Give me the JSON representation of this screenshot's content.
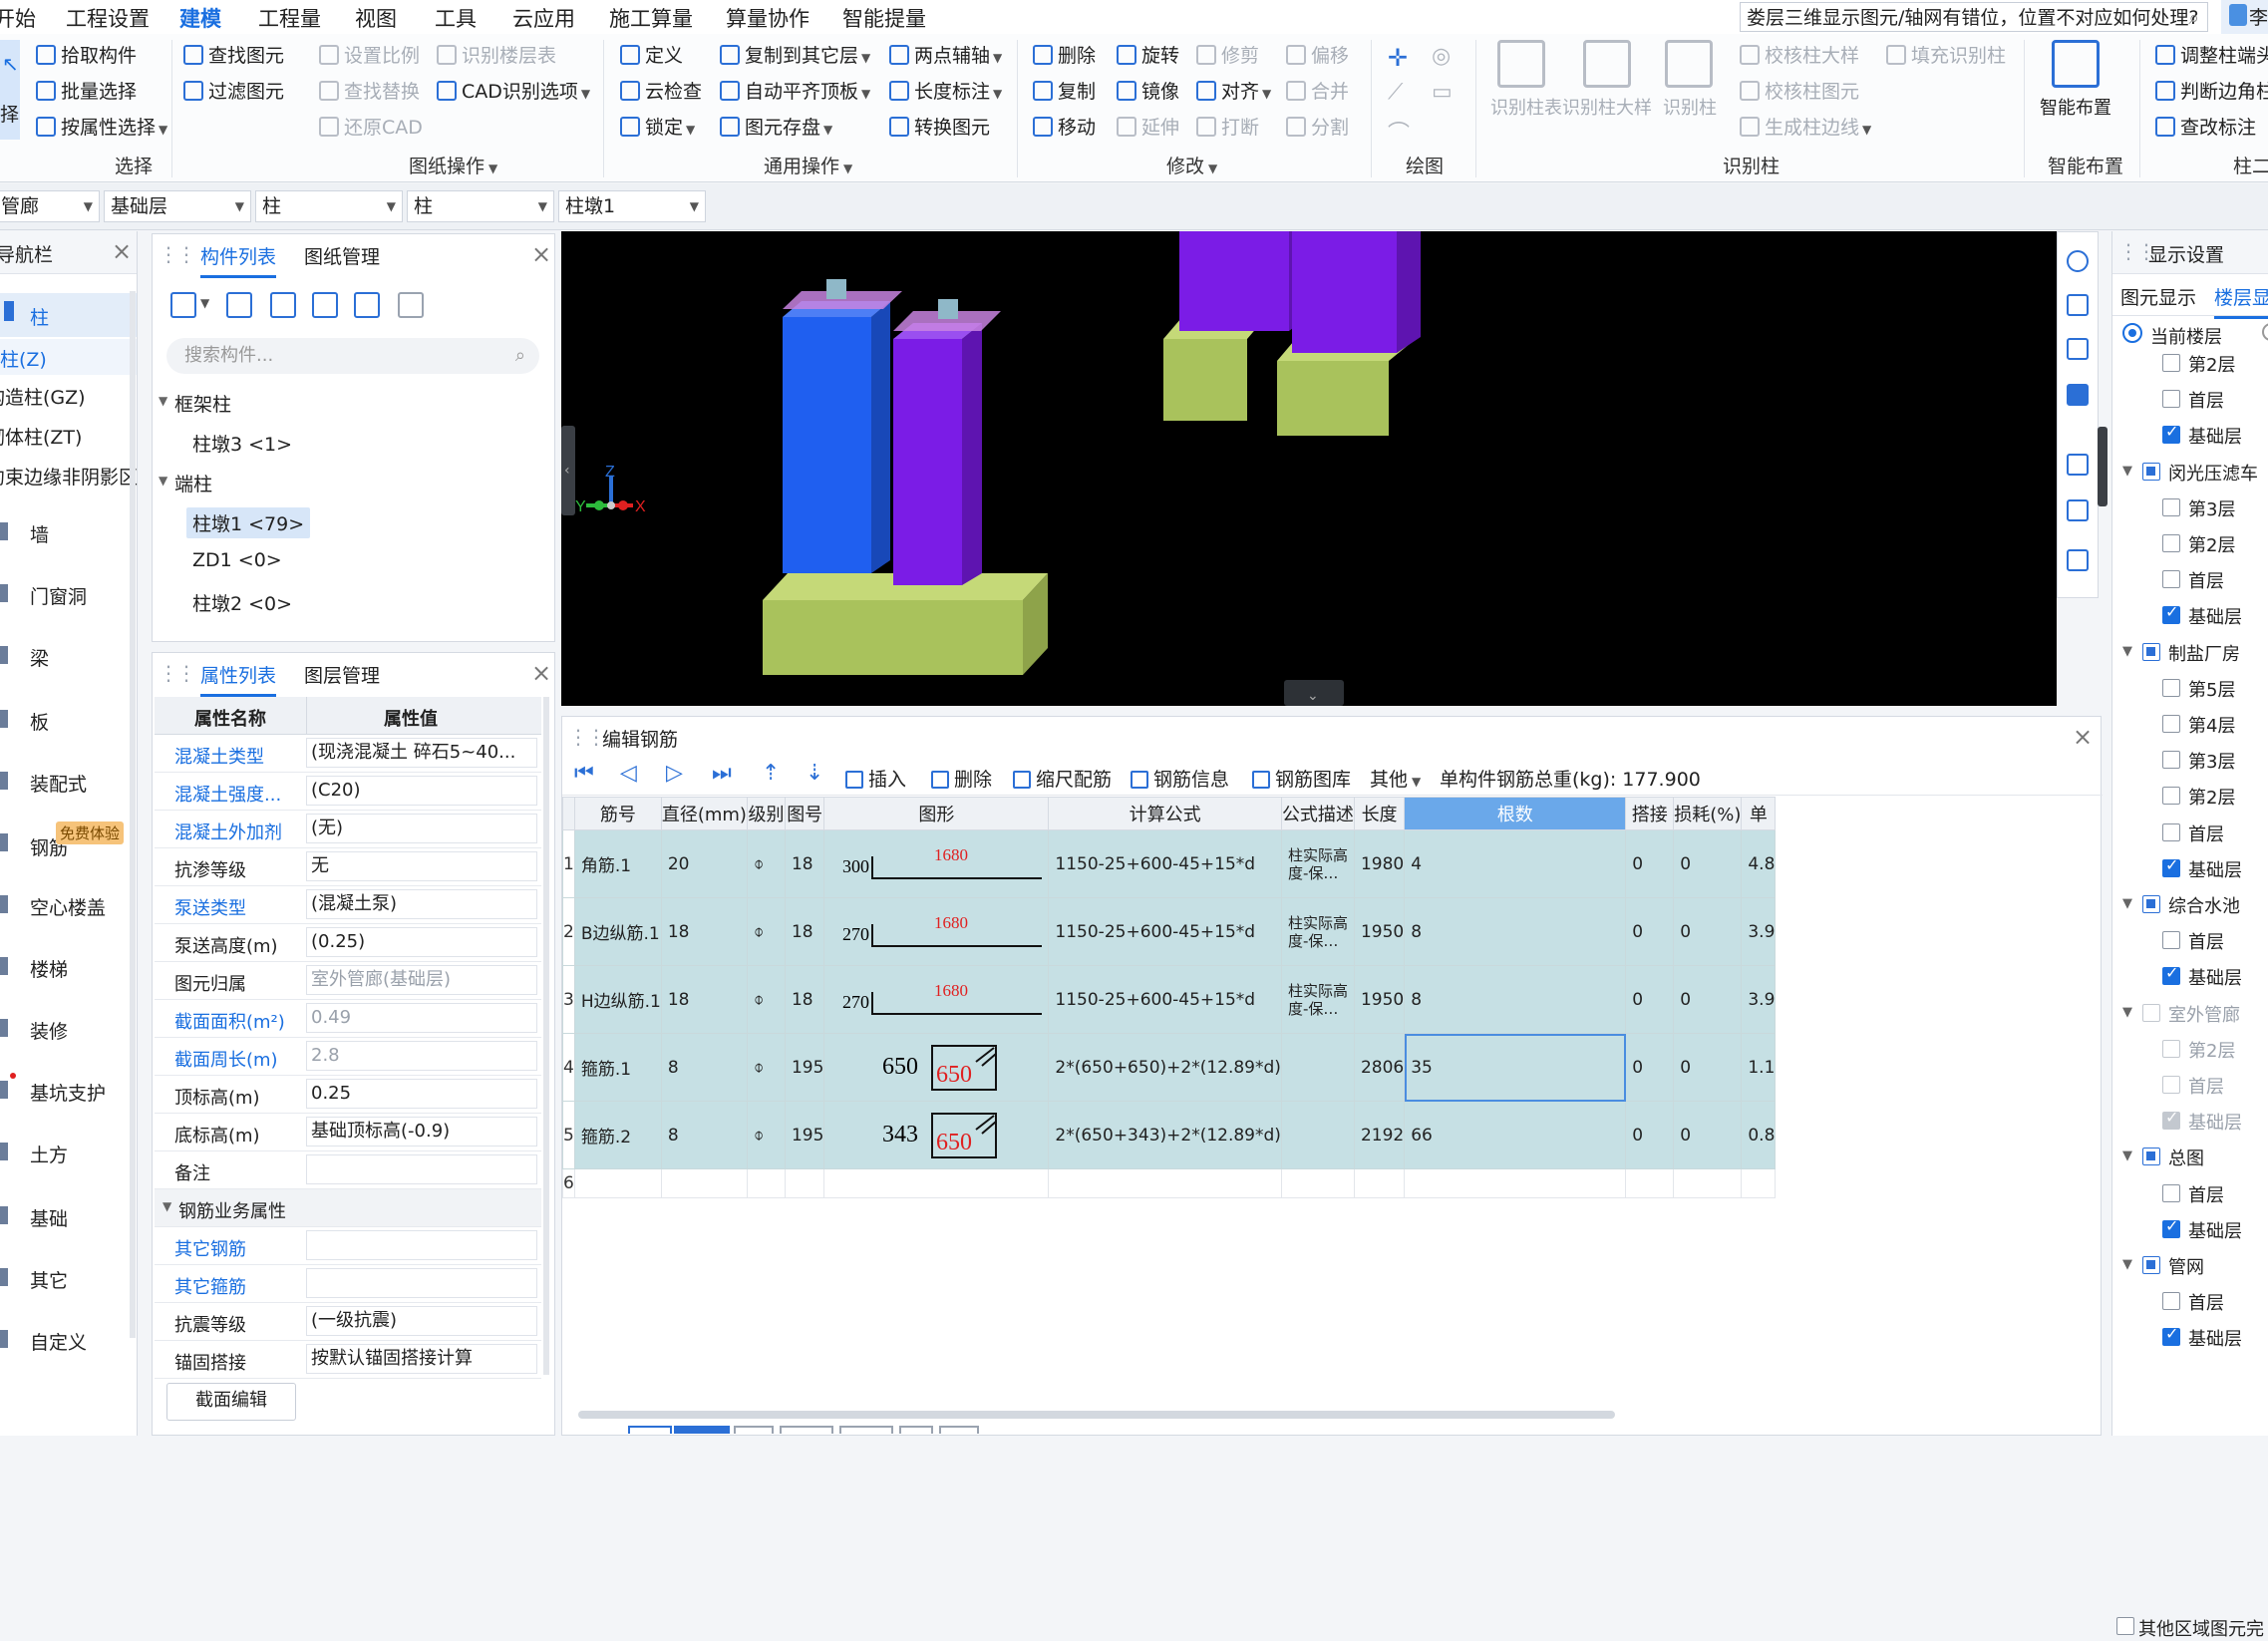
{
  "menubar": {
    "items": [
      "开始",
      "工程设置",
      "建模",
      "工程量",
      "视图",
      "工具",
      "云应用",
      "施工算量",
      "算量协作",
      "智能提量"
    ],
    "active": "建模",
    "help_text": "娄层三维显示图元/轴网有错位，位置不对应如何处理?",
    "user": "李"
  },
  "ribbon": {
    "select_group": {
      "label": "选择",
      "big_button": "择",
      "buttons": [
        "拾取构件",
        "批量选择",
        "按属性选择"
      ]
    },
    "drawing_ops": {
      "label": "图纸操作",
      "col1": [
        "查找图元",
        "过滤图元"
      ],
      "col2": [
        "设置比例",
        "查找替换",
        "还原CAD"
      ],
      "col3": [
        "识别楼层表",
        "CAD识别选项"
      ]
    },
    "general_ops": {
      "label": "通用操作",
      "col1": [
        "定义",
        "云检查",
        "锁定"
      ],
      "col2": [
        "复制到其它层",
        "自动平齐顶板",
        "图元存盘"
      ],
      "col3": [
        "两点辅轴",
        "长度标注",
        "转换图元"
      ]
    },
    "modify": {
      "label": "修改",
      "col1": [
        "删除",
        "复制",
        "移动"
      ],
      "col2": [
        "旋转",
        "镜像",
        "延伸"
      ],
      "col3": [
        "修剪",
        "对齐",
        "打断"
      ],
      "col4": [
        "偏移",
        "合并",
        "分割"
      ]
    },
    "draw": {
      "label": "绘图"
    },
    "recognize_col": {
      "label": "识别柱",
      "big_buttons": [
        "识别柱表",
        "识别柱大样",
        "识别柱"
      ],
      "small": [
        "校核柱大样",
        "校核柱图元",
        "生成柱边线",
        "填充识别柱"
      ]
    },
    "smart_layout": {
      "label": "智能布置",
      "big_button": "智能布置"
    },
    "column_extra": {
      "label": "柱二",
      "buttons": [
        "调整柱端头",
        "判断边角柱",
        "查改标注"
      ]
    }
  },
  "selectors": [
    "管廊",
    "基础层",
    "柱",
    "柱",
    "柱墩1"
  ],
  "nav": {
    "title": "导航栏",
    "items": [
      "柱",
      "柱(Z)",
      "构造柱(GZ)",
      "砌体柱(ZT)",
      "约束边缘非阴影区",
      "墙",
      "门窗洞",
      "梁",
      "板",
      "装配式",
      "钢筋",
      "空心楼盖",
      "楼梯",
      "装修",
      "基坑支护",
      "土方",
      "基础",
      "其它",
      "自定义"
    ],
    "badge": "免费体验"
  },
  "component_panel": {
    "tabs": [
      "构件列表",
      "图纸管理"
    ],
    "search_placeholder": "搜索构件...",
    "tree": [
      {
        "label": "框架柱",
        "type": "group"
      },
      {
        "label": "柱墩3 <1>",
        "type": "item"
      },
      {
        "label": "端柱",
        "type": "group"
      },
      {
        "label": "柱墩1 <79>",
        "type": "item",
        "selected": true
      },
      {
        "label": "ZD1 <0>",
        "type": "item"
      },
      {
        "label": "柱墩2 <0>",
        "type": "item"
      }
    ]
  },
  "property_panel": {
    "tabs": [
      "属性列表",
      "图层管理"
    ],
    "header": [
      "属性名称",
      "属性值"
    ],
    "rows": [
      {
        "name": "混凝土类型",
        "value": "(现浇混凝土    碎石5~40...",
        "blue": true
      },
      {
        "name": "混凝土强度...",
        "value": "(C20)",
        "blue": true
      },
      {
        "name": "混凝土外加剂",
        "value": "(无)",
        "blue": true
      },
      {
        "name": "抗渗等级",
        "value": "无",
        "blue": false
      },
      {
        "name": "泵送类型",
        "value": "(混凝土泵)",
        "blue": true
      },
      {
        "name": "泵送高度(m)",
        "value": "(0.25)",
        "blue": false
      },
      {
        "name": "图元归属",
        "value": "室外管廊(基础层)",
        "blue": false,
        "grey": true
      },
      {
        "name": "截面面积(m²)",
        "value": "0.49",
        "blue": true,
        "grey": true
      },
      {
        "name": "截面周长(m)",
        "value": "2.8",
        "blue": true,
        "grey": true
      },
      {
        "name": "顶标高(m)",
        "value": "0.25",
        "blue": false
      },
      {
        "name": "底标高(m)",
        "value": "基础顶标高(-0.9)",
        "blue": false
      },
      {
        "name": "备注",
        "value": "",
        "blue": false
      }
    ],
    "section": "钢筋业务属性",
    "rows2": [
      {
        "name": "其它钢筋",
        "value": "",
        "blue": true
      },
      {
        "name": "其它箍筋",
        "value": "",
        "blue": true
      },
      {
        "name": "抗震等级",
        "value": "(一级抗震)",
        "blue": false
      },
      {
        "name": "锚固搭接",
        "value": "按默认锚固搭接计算",
        "blue": false
      }
    ],
    "section_edit": "截面编辑"
  },
  "view3d": {
    "axis": {
      "x": "X",
      "y": "Y",
      "z": "Z"
    },
    "colors": {
      "footing": "#a7c25a",
      "col_blue": "#1f5ff0",
      "col_purple": "#7b1ce6",
      "cap": "#c77fe0"
    }
  },
  "rebar_editor": {
    "title": "编辑钢筋",
    "toolbar": [
      "插入",
      "删除",
      "缩尺配筋",
      "钢筋信息",
      "钢筋图库",
      "其他"
    ],
    "total_label": "单构件钢筋总重(kg):",
    "total_value": "177.900",
    "columns": [
      "",
      "筋号",
      "直径(mm)",
      "级别",
      "图号",
      "图形",
      "计算公式",
      "公式描述",
      "长度",
      "根数",
      "搭接",
      "损耗(%)",
      "单"
    ],
    "rows": [
      {
        "no": "1",
        "name": "角筋.1",
        "dia": "20",
        "grade": "⌽",
        "fig": "18",
        "shape": {
          "type": "L",
          "left": "300",
          "len": "1680"
        },
        "formula": "1150-25+600-45+15*d",
        "desc": "柱实际高度-保…",
        "length": "1980",
        "count": "4",
        "lap": "0",
        "loss": "0",
        "unit": "4.8"
      },
      {
        "no": "2",
        "name": "B边纵筋.1",
        "dia": "18",
        "grade": "⌽",
        "fig": "18",
        "shape": {
          "type": "L",
          "left": "270",
          "len": "1680"
        },
        "formula": "1150-25+600-45+15*d",
        "desc": "柱实际高度-保…",
        "length": "1950",
        "count": "8",
        "lap": "0",
        "loss": "0",
        "unit": "3.9"
      },
      {
        "no": "3",
        "name": "H边纵筋.1",
        "dia": "18",
        "grade": "⌽",
        "fig": "18",
        "shape": {
          "type": "L",
          "left": "270",
          "len": "1680"
        },
        "formula": "1150-25+600-45+15*d",
        "desc": "柱实际高度-保…",
        "length": "1950",
        "count": "8",
        "lap": "0",
        "loss": "0",
        "unit": "3.9"
      },
      {
        "no": "4",
        "name": "箍筋.1",
        "dia": "8",
        "grade": "⌽",
        "fig": "195",
        "shape": {
          "type": "box",
          "left": "650",
          "len": "650"
        },
        "formula": "2*(650+650)+2*(12.89*d)",
        "desc": "",
        "length": "2806",
        "count": "35",
        "lap": "0",
        "loss": "0",
        "unit": "1.1"
      },
      {
        "no": "5",
        "name": "箍筋.2",
        "dia": "8",
        "grade": "⌽",
        "fig": "195",
        "shape": {
          "type": "box",
          "left": "343",
          "len": "650"
        },
        "formula": "2*(650+343)+2*(12.89*d)",
        "desc": "",
        "length": "2192",
        "count": "66",
        "lap": "0",
        "loss": "0",
        "unit": "0.8"
      }
    ],
    "empty_row_no": "6"
  },
  "display_settings": {
    "title": "显示设置",
    "tabs": [
      "图元显示",
      "楼层显"
    ],
    "radio_label": "当前楼层",
    "items": [
      {
        "label": "第2层",
        "level": 2,
        "checked": false
      },
      {
        "label": "首层",
        "level": 2,
        "checked": false
      },
      {
        "label": "基础层",
        "level": 2,
        "checked": true
      },
      {
        "label": "闵光压滤车",
        "level": 1,
        "checked": "partial"
      },
      {
        "label": "第3层",
        "level": 2,
        "checked": false
      },
      {
        "label": "第2层",
        "level": 2,
        "checked": false
      },
      {
        "label": "首层",
        "level": 2,
        "checked": false
      },
      {
        "label": "基础层",
        "level": 2,
        "checked": true
      },
      {
        "label": "制盐厂房",
        "level": 1,
        "checked": "partial"
      },
      {
        "label": "第5层",
        "level": 2,
        "checked": false
      },
      {
        "label": "第4层",
        "level": 2,
        "checked": false
      },
      {
        "label": "第3层",
        "level": 2,
        "checked": false
      },
      {
        "label": "第2层",
        "level": 2,
        "checked": false
      },
      {
        "label": "首层",
        "level": 2,
        "checked": false
      },
      {
        "label": "基础层",
        "level": 2,
        "checked": true
      },
      {
        "label": "综合水池",
        "level": 1,
        "checked": "partial"
      },
      {
        "label": "首层",
        "level": 2,
        "checked": false
      },
      {
        "label": "基础层",
        "level": 2,
        "checked": true
      },
      {
        "label": "室外管廊",
        "level": 1,
        "checked": "disabled"
      },
      {
        "label": "第2层",
        "level": 2,
        "checked": "disabled"
      },
      {
        "label": "首层",
        "level": 2,
        "checked": "disabled"
      },
      {
        "label": "基础层",
        "level": 2,
        "checked": "disabled-on"
      },
      {
        "label": "总图",
        "level": 1,
        "checked": "partial"
      },
      {
        "label": "首层",
        "level": 2,
        "checked": false
      },
      {
        "label": "基础层",
        "level": 2,
        "checked": true
      },
      {
        "label": "管网",
        "level": 1,
        "checked": "partial"
      },
      {
        "label": "首层",
        "level": 2,
        "checked": false
      },
      {
        "label": "基础层",
        "level": 2,
        "checked": true
      }
    ],
    "footer": "其他区域图元完"
  }
}
